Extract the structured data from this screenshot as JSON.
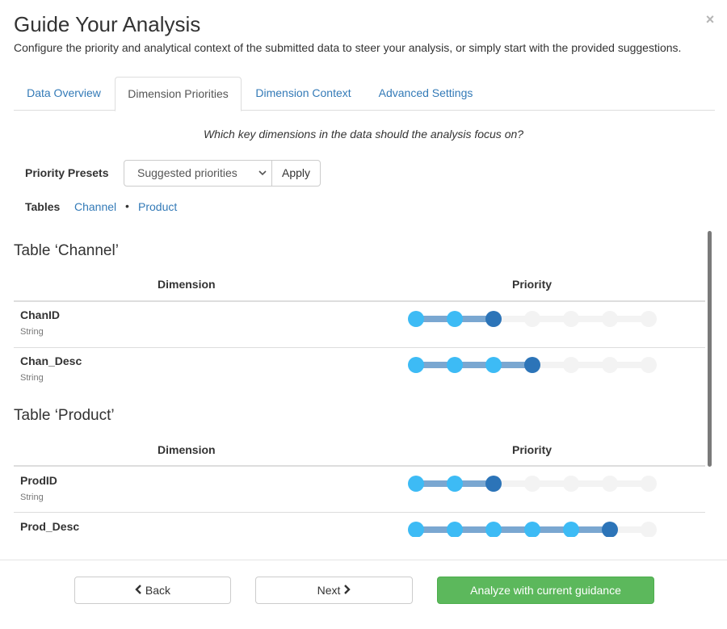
{
  "modal": {
    "title": "Guide Your Analysis",
    "subtitle": "Configure the priority and analytical context of the submitted data to steer your analysis, or simply start with the provided suggestions.",
    "close_glyph": "×"
  },
  "tabs": [
    {
      "label": "Data Overview",
      "active": false
    },
    {
      "label": "Dimension Priorities",
      "active": true
    },
    {
      "label": "Dimension Context",
      "active": false
    },
    {
      "label": "Advanced Settings",
      "active": false
    }
  ],
  "question": "Which key dimensions in the data should the analysis focus on?",
  "presets": {
    "label": "Priority Presets",
    "selected": "Suggested priorities",
    "apply_label": "Apply"
  },
  "tables_nav": {
    "label": "Tables",
    "links": [
      "Channel",
      "Product"
    ],
    "separator": "•"
  },
  "priority_levels": 7,
  "colors": {
    "accent_link": "#337ab7",
    "slider_active": "#3dbbf5",
    "slider_current": "#2c74b8",
    "slider_fill": "#7aa7d1",
    "slider_inactive": "#f3f3f3",
    "primary_button": "#5cb85c"
  },
  "tables": [
    {
      "heading": "Table ‘Channel’",
      "col_dimension": "Dimension",
      "col_priority": "Priority",
      "rows": [
        {
          "name": "ChanID",
          "type": "String",
          "priority": 3
        },
        {
          "name": "Chan_Desc",
          "type": "String",
          "priority": 4
        }
      ]
    },
    {
      "heading": "Table ‘Product’",
      "col_dimension": "Dimension",
      "col_priority": "Priority",
      "rows": [
        {
          "name": "ProdID",
          "type": "String",
          "priority": 3
        },
        {
          "name": "Prod_Desc",
          "type": "",
          "priority": 6
        }
      ]
    }
  ],
  "footer": {
    "back_label": "Back",
    "next_label": "Next",
    "analyze_label": "Analyze with current guidance",
    "back_icon": "chevron-left-icon",
    "next_icon": "chevron-right-icon"
  }
}
